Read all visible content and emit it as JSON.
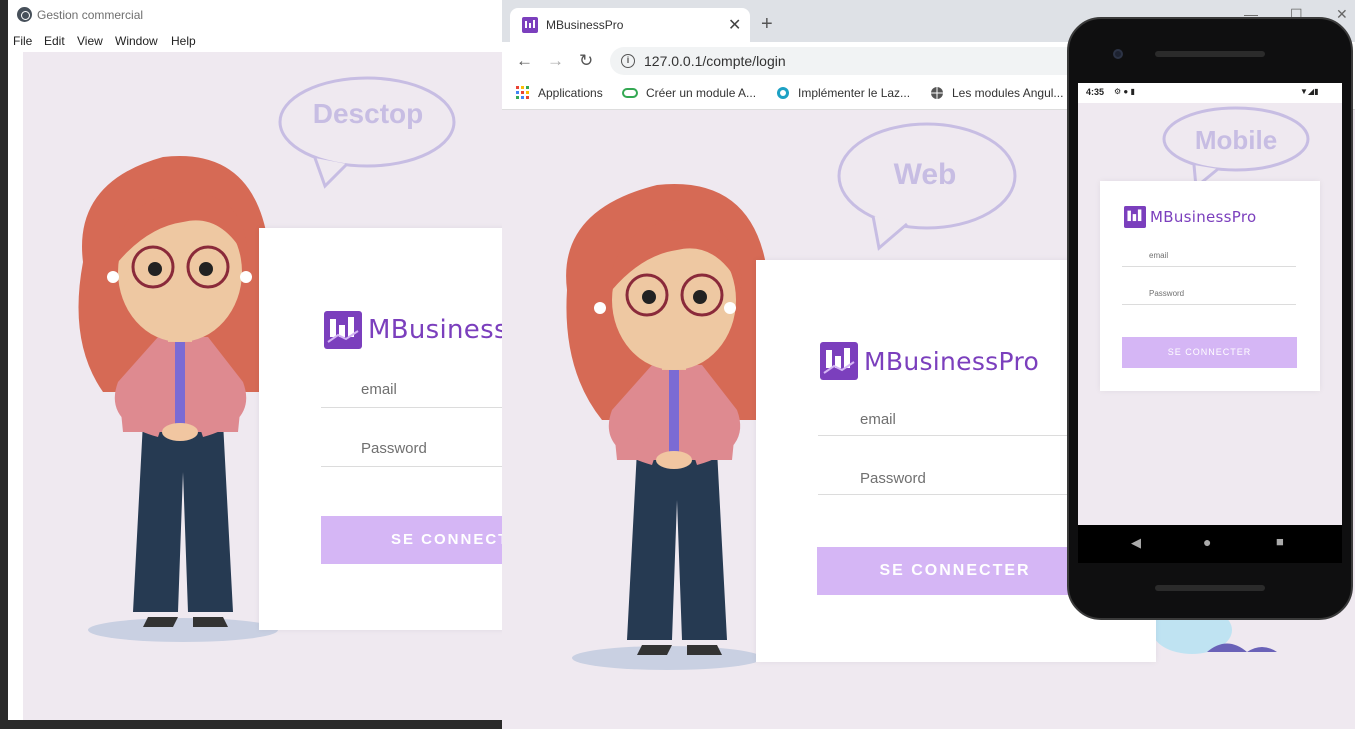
{
  "desktop": {
    "window_title": "Gestion commercial",
    "menu": [
      "File",
      "Edit",
      "View",
      "Window",
      "Help"
    ],
    "bubble_label": "Desctop",
    "brand": "MBusiness",
    "email_placeholder": "email",
    "password_placeholder": "Password",
    "submit_label": "SE CONNECT"
  },
  "web": {
    "tab_title": "MBusinessPro",
    "tab_close": "✕",
    "new_tab": "+",
    "url": "127.0.0.1/compte/login",
    "bookmarks": [
      {
        "label": "Applications",
        "icon": "apps-grid-icon"
      },
      {
        "label": "Créer un module A...",
        "icon": "link-icon"
      },
      {
        "label": "Implémenter le Laz...",
        "icon": "circle-site-icon"
      },
      {
        "label": "Les modules Angul...",
        "icon": "globe-icon"
      }
    ],
    "bubble_label": "Web",
    "brand": "MBusinessPro",
    "email_placeholder": "email",
    "password_placeholder": "Password",
    "submit_label": "SE CONNECTER"
  },
  "mobile": {
    "status_time": "4:35",
    "bubble_label": "Mobile",
    "brand": "MBusinessPro",
    "email_placeholder": "email",
    "password_placeholder": "Password",
    "submit_label": "SE CONNECTER"
  },
  "colors": {
    "background": "#efe9f0",
    "brand_purple": "#7b3fbd",
    "button": "#d5b6f5",
    "bubble": "#c7bde3"
  }
}
